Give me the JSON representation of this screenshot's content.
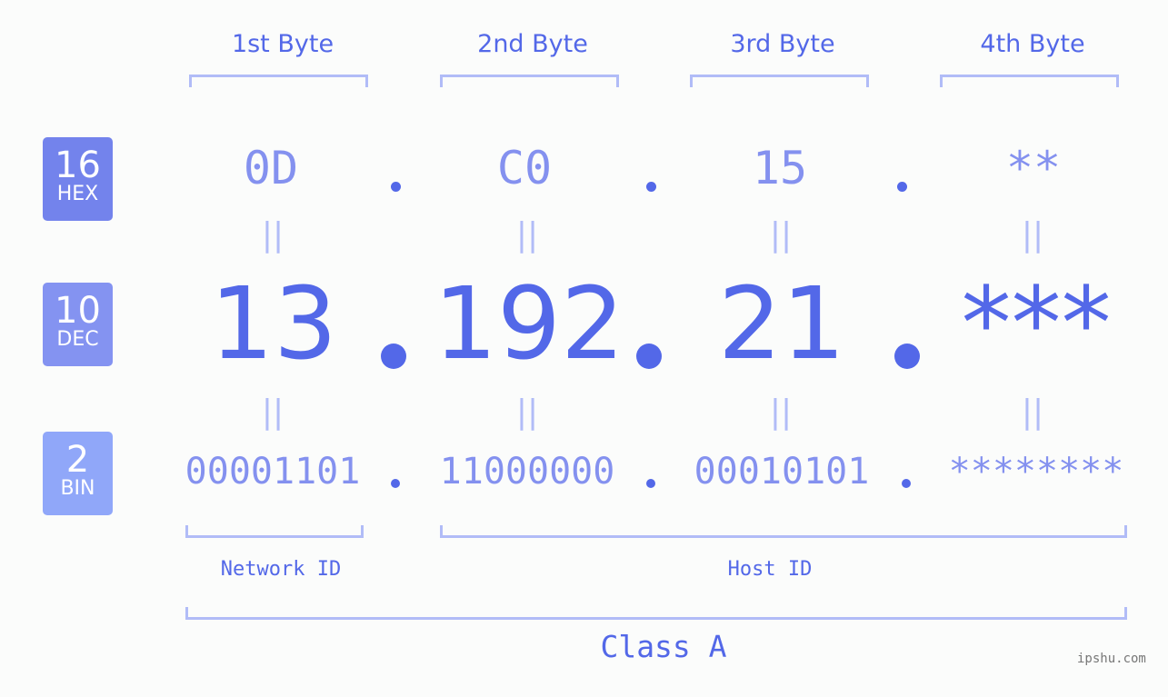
{
  "bytes": [
    {
      "header": "1st Byte",
      "hex": "0D",
      "dec": "13",
      "bin": "00001101"
    },
    {
      "header": "2nd Byte",
      "hex": "C0",
      "dec": "192",
      "bin": "11000000"
    },
    {
      "header": "3rd Byte",
      "hex": "15",
      "dec": "21",
      "bin": "00010101"
    },
    {
      "header": "4th Byte",
      "hex": "**",
      "dec": "***",
      "bin": "********"
    }
  ],
  "badges": {
    "hex": {
      "num": "16",
      "label": "HEX",
      "color": "#7383ec"
    },
    "dec": {
      "num": "10",
      "label": "DEC",
      "color": "#8493f1"
    },
    "bin": {
      "num": "2",
      "label": "BIN",
      "color": "#90a7f9"
    }
  },
  "equals_sign": "||",
  "labels": {
    "network": "Network ID",
    "host": "Host ID",
    "class": "Class A"
  },
  "watermark": "ipshu.com",
  "colors": {
    "accent": "#5368e8",
    "light": "#8491ef",
    "bracket": "#b1bcf7"
  }
}
